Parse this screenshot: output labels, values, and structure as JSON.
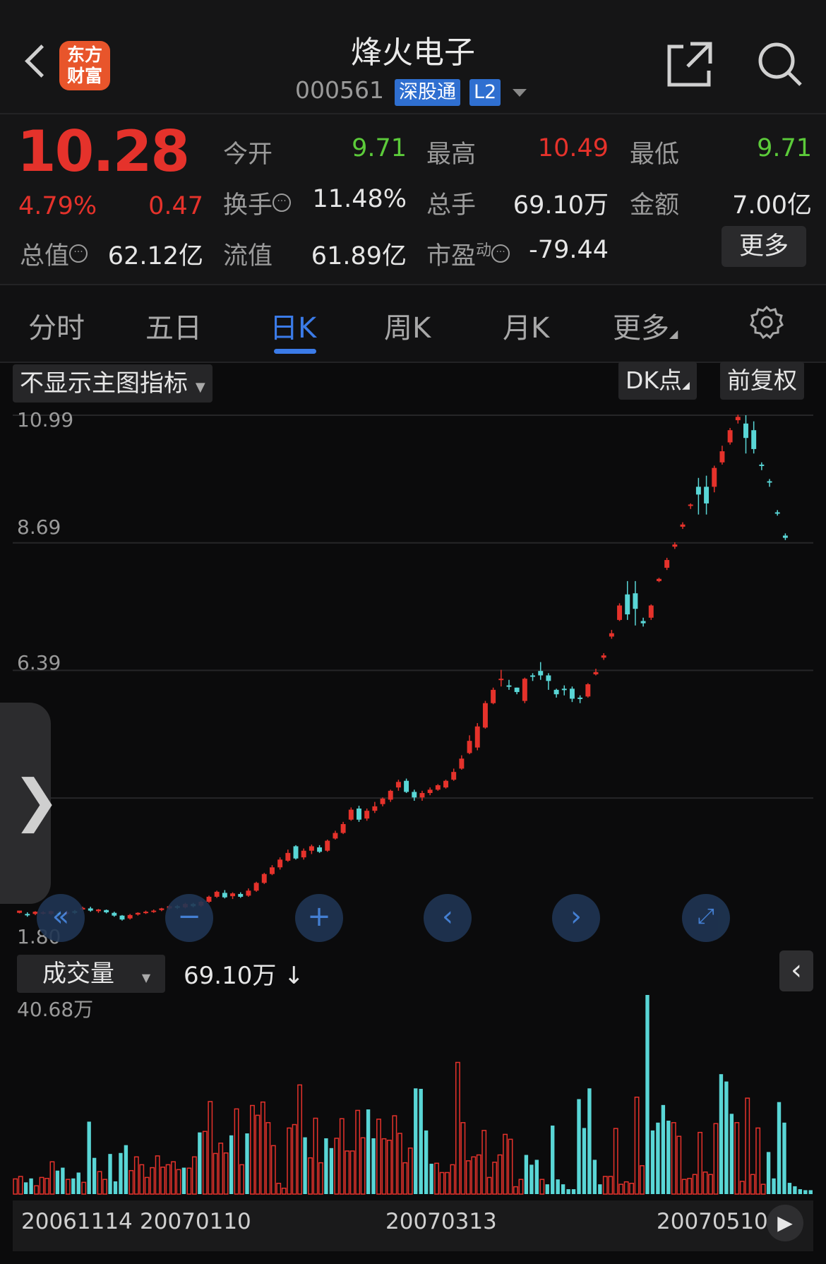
{
  "header": {
    "logo_text_line1": "东方",
    "logo_text_line2": "财富",
    "stock_name": "烽火电子",
    "stock_code": "000561",
    "tag_connect": "深股通",
    "tag_level": "L2"
  },
  "quote": {
    "price": "10.28",
    "change_pct": "4.79%",
    "change_amt": "0.47",
    "open_label": "今开",
    "open": "9.71",
    "high_label": "最高",
    "high": "10.49",
    "low_label": "最低",
    "low": "9.71",
    "turnover_label": "换手",
    "turnover": "11.48%",
    "volume_label": "总手",
    "volume": "69.10万",
    "amount_label": "金额",
    "amount": "7.00亿",
    "mktcap_label": "总值",
    "mktcap": "62.12亿",
    "float_label": "流值",
    "float": "61.89亿",
    "pe_label": "市盈",
    "pe_sup": "动",
    "pe": "-79.44",
    "more_label": "更多"
  },
  "tabs": [
    {
      "label": "分时"
    },
    {
      "label": "五日"
    },
    {
      "label": "日K"
    },
    {
      "label": "周K"
    },
    {
      "label": "月K"
    },
    {
      "label": "更多"
    }
  ],
  "chart_toolbar": {
    "indicator": "不显示主图指标",
    "dk": "DK点",
    "adjust": "前复权"
  },
  "colors": {
    "up": "#e5322b",
    "down": "#59d6d6",
    "accent": "#3b7be8"
  },
  "volume_panel": {
    "selector": "成交量",
    "current": "69.10万 ↓",
    "max_label": "40.68万"
  },
  "chart_data": {
    "type": "candlestick",
    "y_ticks": [
      "10.99",
      "8.69",
      "6.39",
      "",
      "1.80"
    ],
    "ylim": [
      1.8,
      10.99
    ],
    "x_ticks": [
      "20061114",
      "20070110",
      "20070313",
      "20070510"
    ],
    "volume_ylim": [
      0,
      40.68
    ],
    "candles": [
      [
        2.02,
        2.06,
        2.01,
        2.05,
        1
      ],
      [
        2.0,
        1.99,
        1.95,
        2.03,
        0
      ],
      [
        2.0,
        2.04,
        1.98,
        2.05,
        1
      ],
      [
        2.02,
        2.03,
        1.99,
        2.05,
        1
      ],
      [
        2.0,
        2.05,
        1.98,
        2.06,
        1
      ],
      [
        2.02,
        2.0,
        1.96,
        2.05,
        0
      ],
      [
        2.0,
        2.03,
        1.97,
        2.06,
        1
      ],
      [
        2.05,
        2.02,
        2.0,
        2.07,
        0
      ],
      [
        2.08,
        2.11,
        2.06,
        2.13,
        1
      ],
      [
        2.1,
        2.06,
        2.04,
        2.13,
        0
      ],
      [
        2.05,
        2.08,
        2.02,
        2.09,
        1
      ],
      [
        2.07,
        2.03,
        2.01,
        2.08,
        0
      ],
      [
        2.02,
        1.97,
        1.95,
        2.04,
        0
      ],
      [
        1.97,
        1.9,
        1.88,
        1.98,
        0
      ],
      [
        1.92,
        1.98,
        1.9,
        2.0,
        1
      ],
      [
        1.99,
        2.02,
        1.97,
        2.03,
        1
      ],
      [
        2.02,
        2.04,
        2.0,
        2.06,
        1
      ],
      [
        2.04,
        2.06,
        2.02,
        2.08,
        1
      ],
      [
        2.07,
        2.1,
        2.05,
        2.11,
        1
      ],
      [
        2.1,
        2.14,
        2.08,
        2.16,
        1
      ],
      [
        2.14,
        2.11,
        2.09,
        2.16,
        0
      ],
      [
        2.12,
        2.18,
        2.1,
        2.2,
        1
      ],
      [
        2.18,
        2.14,
        2.12,
        2.2,
        0
      ],
      [
        2.15,
        2.22,
        2.13,
        2.24,
        1
      ],
      [
        2.22,
        2.31,
        2.2,
        2.33,
        1
      ],
      [
        2.31,
        2.4,
        2.29,
        2.42,
        1
      ],
      [
        2.38,
        2.3,
        2.28,
        2.43,
        0
      ],
      [
        2.32,
        2.37,
        2.27,
        2.39,
        1
      ],
      [
        2.36,
        2.31,
        2.29,
        2.39,
        0
      ],
      [
        2.33,
        2.42,
        2.31,
        2.46,
        1
      ],
      [
        2.42,
        2.56,
        2.4,
        2.58,
        1
      ],
      [
        2.56,
        2.72,
        2.54,
        2.74,
        1
      ],
      [
        2.72,
        2.84,
        2.7,
        2.88,
        1
      ],
      [
        2.84,
        2.98,
        2.8,
        3.02,
        1
      ],
      [
        2.96,
        3.1,
        2.94,
        3.16,
        1
      ],
      [
        3.22,
        3.0,
        2.98,
        3.24,
        0
      ],
      [
        3.02,
        3.14,
        2.98,
        3.18,
        1
      ],
      [
        3.14,
        3.22,
        3.08,
        3.25,
        1
      ],
      [
        3.2,
        3.12,
        3.1,
        3.24,
        0
      ],
      [
        3.14,
        3.32,
        3.12,
        3.34,
        1
      ],
      [
        3.36,
        3.46,
        3.34,
        3.5,
        1
      ],
      [
        3.46,
        3.62,
        3.44,
        3.66,
        1
      ],
      [
        3.7,
        3.88,
        3.68,
        3.92,
        1
      ],
      [
        3.9,
        3.7,
        3.66,
        3.95,
        0
      ],
      [
        3.72,
        3.86,
        3.68,
        3.9,
        1
      ],
      [
        3.86,
        3.94,
        3.82,
        4.02,
        1
      ],
      [
        3.98,
        4.08,
        3.94,
        4.1,
        1
      ],
      [
        4.06,
        4.22,
        4.02,
        4.24,
        1
      ],
      [
        4.28,
        4.38,
        4.22,
        4.42,
        1
      ],
      [
        4.4,
        4.2,
        4.18,
        4.44,
        0
      ],
      [
        4.2,
        4.1,
        4.04,
        4.24,
        0
      ],
      [
        4.1,
        4.18,
        4.04,
        4.22,
        1
      ],
      [
        4.18,
        4.24,
        4.14,
        4.28,
        1
      ],
      [
        4.24,
        4.32,
        4.22,
        4.34,
        1
      ],
      [
        4.28,
        4.4,
        4.26,
        4.42,
        1
      ],
      [
        4.42,
        4.56,
        4.4,
        4.62,
        1
      ],
      [
        4.62,
        4.8,
        4.6,
        4.86,
        1
      ],
      [
        4.9,
        5.12,
        4.88,
        5.22,
        1
      ],
      [
        5.0,
        5.38,
        4.95,
        5.44,
        1
      ],
      [
        5.36,
        5.8,
        5.34,
        5.84,
        1
      ],
      [
        5.8,
        6.04,
        5.78,
        6.08,
        1
      ],
      [
        6.22,
        6.24,
        6.1,
        6.4,
        1
      ],
      [
        6.1,
        6.12,
        6.04,
        6.22,
        0
      ],
      [
        6.08,
        6.0,
        5.96,
        6.08,
        0
      ],
      [
        5.84,
        6.24,
        5.8,
        6.26,
        1
      ],
      [
        6.3,
        6.28,
        6.2,
        6.34,
        0
      ],
      [
        6.38,
        6.3,
        6.22,
        6.54,
        0
      ],
      [
        6.3,
        6.2,
        6.04,
        6.34,
        0
      ],
      [
        6.04,
        5.96,
        5.9,
        6.06,
        0
      ],
      [
        6.06,
        6.04,
        5.94,
        6.12,
        0
      ],
      [
        6.06,
        5.88,
        5.82,
        6.1,
        0
      ],
      [
        5.9,
        5.88,
        5.8,
        5.94,
        0
      ],
      [
        5.92,
        6.14,
        5.9,
        6.16,
        1
      ],
      [
        6.32,
        6.36,
        6.3,
        6.42,
        1
      ],
      [
        6.62,
        6.66,
        6.58,
        6.7,
        1
      ],
      [
        7.0,
        7.06,
        6.96,
        7.12,
        1
      ],
      [
        7.3,
        7.56,
        7.28,
        7.6,
        1
      ],
      [
        7.76,
        7.4,
        7.3,
        8.0,
        0
      ],
      [
        7.5,
        7.78,
        7.2,
        8.0,
        0
      ],
      [
        7.28,
        7.24,
        7.18,
        7.34,
        0
      ],
      [
        7.34,
        7.56,
        7.3,
        7.58,
        1
      ],
      [
        8.0,
        8.04,
        7.98,
        8.06,
        1
      ],
      [
        8.24,
        8.38,
        8.2,
        8.42,
        1
      ],
      [
        8.62,
        8.66,
        8.58,
        8.7,
        1
      ],
      [
        8.98,
        9.02,
        8.94,
        9.06,
        1
      ],
      [
        9.36,
        9.38,
        9.3,
        9.4,
        1
      ],
      [
        9.7,
        9.56,
        9.2,
        9.86,
        0
      ],
      [
        9.4,
        9.7,
        9.2,
        9.9,
        0
      ],
      [
        9.7,
        10.04,
        9.6,
        10.08,
        1
      ],
      [
        10.14,
        10.34,
        10.1,
        10.44,
        1
      ],
      [
        10.5,
        10.72,
        10.46,
        10.76,
        1
      ],
      [
        10.9,
        10.96,
        10.84,
        11.0,
        1
      ],
      [
        10.84,
        10.58,
        10.3,
        10.99,
        0
      ],
      [
        10.72,
        10.38,
        10.3,
        10.88,
        0
      ],
      [
        10.1,
        10.08,
        10.0,
        10.14,
        0
      ],
      [
        9.8,
        9.78,
        9.7,
        9.84,
        0
      ],
      [
        9.24,
        9.22,
        9.18,
        9.28,
        0
      ],
      [
        8.82,
        8.78,
        8.74,
        8.86,
        0
      ]
    ],
    "volumes": [
      3.1,
      3.6,
      2.4,
      3.2,
      1.7,
      3.4,
      3.2,
      6.6,
      4.8,
      5.4,
      3.0,
      3.2,
      4.4,
      2.4,
      14.8,
      7.4,
      4.6,
      3.0,
      8.2,
      2.6,
      8.4,
      10.0,
      4.8,
      7.6,
      6.0,
      3.4,
      5.4,
      7.8,
      5.5,
      6.0,
      6.6,
      5.0,
      5.4,
      5.3,
      7.6,
      12.6,
      12.8,
      18.9,
      8.3,
      10.4,
      8.4,
      12.0,
      17.4,
      6.0,
      12.4,
      18.1,
      16.1,
      18.8,
      14.6,
      9.9,
      2.2,
      1.2,
      13.5,
      14.2,
      22.3,
      11.6,
      7.4,
      15.5,
      6.4,
      11.4,
      9.4,
      11.4,
      15.4,
      8.8,
      8.8,
      17.1,
      11.5,
      17.3,
      11.4,
      15.3,
      11.3,
      11.0,
      16.0,
      12.4,
      6.4,
      9.4,
      21.6,
      21.5,
      13.0,
      6.2,
      6.3,
      4.4,
      4.4,
      6.0,
      26.9,
      14.6,
      6.8,
      7.6,
      8.0,
      13.0,
      3.4,
      6.5,
      8.0,
      12.2,
      11.2,
      1.5,
      3.0,
      8.0,
      6.0,
      7.0,
      3.0,
      2.0,
      14.0,
      3.0,
      2.0,
      1.0,
      1.0,
      19.4,
      13.5,
      21.6,
      7.0,
      2.0,
      3.6,
      3.6,
      13.4,
      2.0,
      2.5,
      2.2,
      19.8,
      5.8,
      40.68,
      13.0,
      14.6,
      18.2,
      15.0,
      14.6,
      11.8,
      3.0,
      3.2,
      4.0,
      12.6,
      4.5,
      4.0,
      14.4,
      24.5,
      23.0,
      16.4,
      14.6,
      2.6,
      19.6,
      4.0,
      13.5,
      2.0,
      8.6,
      3.2,
      18.8,
      14.6,
      2.3,
      1.6,
      1.0,
      0.8,
      0.8
    ]
  }
}
